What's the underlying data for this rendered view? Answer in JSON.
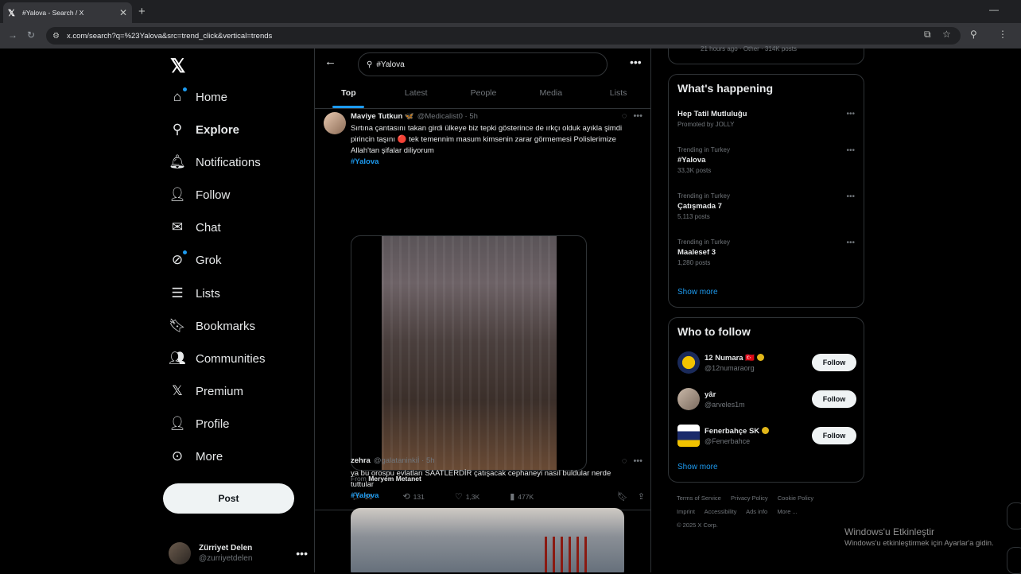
{
  "browser": {
    "tab_title": "#Yalova - Search / X",
    "url": "x.com/search?q=%23Yalova&src=trend_click&vertical=trends"
  },
  "sidebar": {
    "items": [
      {
        "label": "Home",
        "icon": "home-icon"
      },
      {
        "label": "Explore",
        "icon": "search-icon"
      },
      {
        "label": "Notifications",
        "icon": "bell-icon"
      },
      {
        "label": "Follow",
        "icon": "person-add-icon"
      },
      {
        "label": "Chat",
        "icon": "mail-icon"
      },
      {
        "label": "Grok",
        "icon": "grok-icon"
      },
      {
        "label": "Lists",
        "icon": "list-icon"
      },
      {
        "label": "Bookmarks",
        "icon": "bookmark-icon"
      },
      {
        "label": "Communities",
        "icon": "communities-icon"
      },
      {
        "label": "Premium",
        "icon": "x-icon"
      },
      {
        "label": "Profile",
        "icon": "person-icon"
      },
      {
        "label": "More",
        "icon": "more-circle-icon"
      }
    ],
    "post_label": "Post",
    "account": {
      "name": "Zürriyet Delen",
      "handle": "@zurriyetdelen"
    }
  },
  "search": {
    "query": "#Yalova"
  },
  "tabs": [
    "Top",
    "Latest",
    "People",
    "Media",
    "Lists"
  ],
  "tweets": [
    {
      "name": "Maviye Tutkun 🦋",
      "handle": "@Medicalist0 · 5h",
      "text": "Sırtına çantasını takan girdi ülkeye biz tepki gösterince de ırkçı olduk ayıkla şimdi pirincin taşını 🔴 tek temennim masum kimsenin zarar görmemesi Polislerimize Allah'tan şifalar diliyorum",
      "hashtag": "#Yalova",
      "from_prefix": "From",
      "from_name": "Meryem Metanet",
      "replies": "21",
      "reposts": "131",
      "likes": "1,3K",
      "views": "477K"
    },
    {
      "name": "zehra",
      "handle": "@galataninkiİ · 5h",
      "text": "ya bu orospu evlatları SAATLERDİR çatışacak cephaneyi nasıl buldular nerde tuttular",
      "hashtag": "#Yalova"
    }
  ],
  "top_card_partial": "21 hours ago · Other · 314K posts",
  "whats_happening": {
    "title": "What's happening",
    "promo": {
      "title": "Hep Tatil Mutluluğu",
      "sub": "Promoted by JOLLY"
    },
    "trends": [
      {
        "context": "Trending in Turkey",
        "title": "#Yalova",
        "count": "33,3K posts"
      },
      {
        "context": "Trending in Turkey",
        "title": "Çatışmada 7",
        "count": "5,113 posts"
      },
      {
        "context": "Trending in Turkey",
        "title": "Maalesef 3",
        "count": "1,280 posts"
      }
    ],
    "show_more": "Show more"
  },
  "who_to_follow": {
    "title": "Who to follow",
    "accounts": [
      {
        "name": "12 Numara 🇹🇷",
        "handle": "@12numaraorg",
        "button": "Follow"
      },
      {
        "name": "yâr",
        "handle": "@arveles1m",
        "button": "Follow"
      },
      {
        "name": "Fenerbahçe SK",
        "handle": "@Fenerbahce",
        "button": "Follow"
      }
    ],
    "show_more": "Show more"
  },
  "footer": {
    "links": [
      "Terms of Service",
      "Privacy Policy",
      "Cookie Policy",
      "Imprint",
      "Accessibility",
      "Ads info",
      "More ..."
    ],
    "copyright": "© 2025 X Corp."
  },
  "watermark": {
    "line1": "Windows'u Etkinleştir",
    "line2": "Windows'u etkinleştirmek için Ayarlar'a gidin."
  },
  "colors": {
    "accent": "#1d9bf0",
    "bg": "#000000",
    "border": "#2f3336",
    "muted": "#71767b"
  }
}
